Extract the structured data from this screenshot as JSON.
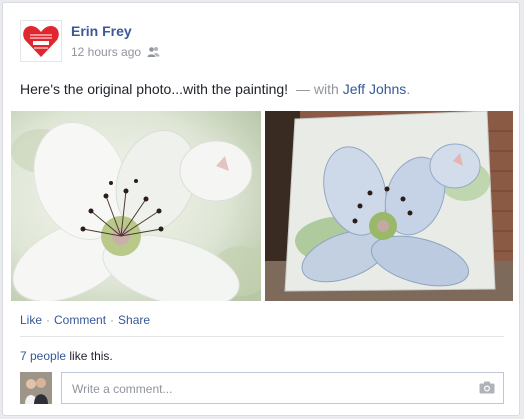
{
  "post": {
    "author": "Erin Frey",
    "time": "12 hours ago",
    "audience_icon": "friends-icon",
    "avatar_icon": "heart-logo-icon",
    "text": "Here's the original photo...with the painting!",
    "with_separator": "— with",
    "tagged_person": "Jeff Johns",
    "tagged_suffix": "."
  },
  "photos": [
    {
      "icon": "flower-photo-icon"
    },
    {
      "icon": "flower-painting-icon"
    }
  ],
  "actions": {
    "like_label": "Like",
    "comment_label": "Comment",
    "share_label": "Share",
    "separator": "·"
  },
  "likes": {
    "count_text": "7 people",
    "suffix": "like this."
  },
  "comment": {
    "placeholder": "Write a comment...",
    "camera_icon": "camera-icon"
  },
  "colors": {
    "link": "#365899",
    "author": "#3b5998",
    "meta": "#90949c",
    "heart": "#e0272f"
  }
}
